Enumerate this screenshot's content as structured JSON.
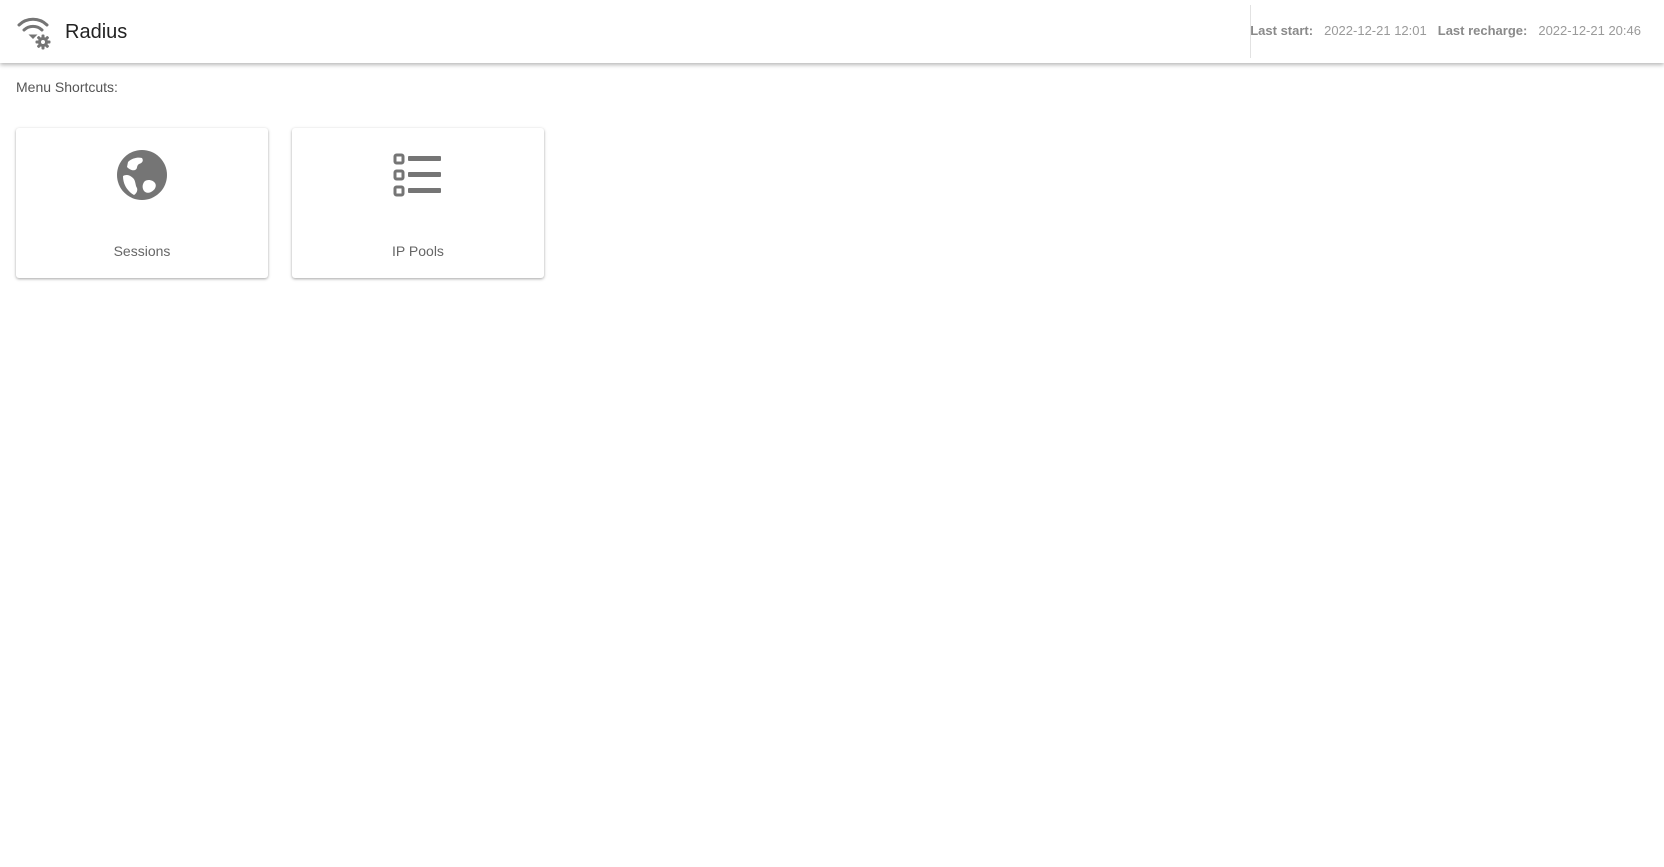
{
  "header": {
    "title": "Radius",
    "icon": "wifi-gear-icon",
    "last_start_label": "Last start:",
    "last_start_value": "2022-12-21 12:01",
    "last_recharge_label": "Last recharge:",
    "last_recharge_value": "2022-12-21 20:46"
  },
  "main": {
    "shortcuts_label": "Menu Shortcuts:",
    "shortcuts": [
      {
        "label": "Sessions",
        "icon": "globe-icon"
      },
      {
        "label": "IP Pools",
        "icon": "checklist-icon"
      }
    ]
  },
  "colors": {
    "icon": "#757575",
    "text": "#444444",
    "header_bg": "#ffffff"
  }
}
